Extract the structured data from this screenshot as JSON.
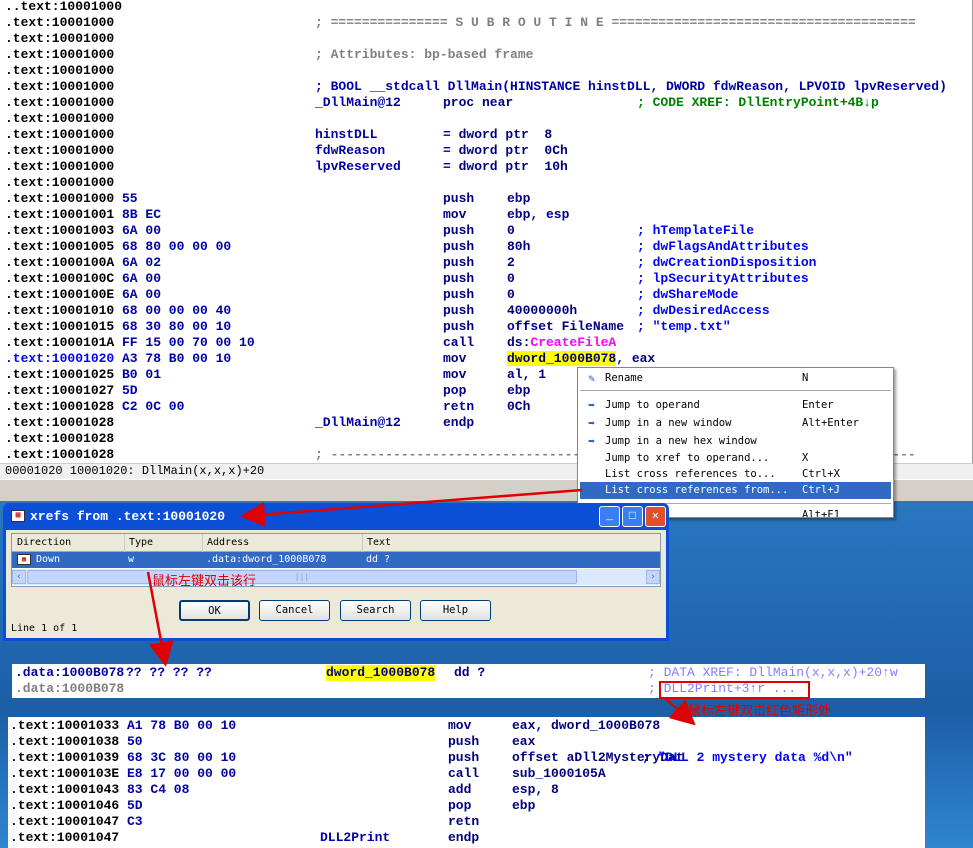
{
  "listing": [
    [
      "..text:10001000",
      "",
      "",
      "",
      "",
      ""
    ],
    [
      ".text:10001000",
      "",
      "; =============== S U B R O U T I N E =======================================",
      "",
      "",
      ""
    ],
    [
      ".text:10001000",
      "",
      "",
      "",
      "",
      ""
    ],
    [
      ".text:10001000",
      "",
      "; Attributes: bp-based frame",
      "",
      "",
      ""
    ],
    [
      ".text:10001000",
      "",
      "",
      "",
      "",
      ""
    ],
    [
      ".text:10001000",
      "",
      "; BOOL __stdcall DllMain(HINSTANCE hinstDLL, DWORD fdwReason, LPVOID lpvReserved)",
      "",
      "",
      ""
    ],
    [
      ".text:10001000",
      "",
      "_DllMain@12",
      "proc near",
      "",
      "; CODE XREF: DllEntryPoint+4B↓p"
    ],
    [
      ".text:10001000",
      "",
      "",
      "",
      "",
      ""
    ],
    [
      ".text:10001000",
      "",
      "hinstDLL",
      "= dword ptr  8",
      "",
      ""
    ],
    [
      ".text:10001000",
      "",
      "fdwReason",
      "= dword ptr  0Ch",
      "",
      ""
    ],
    [
      ".text:10001000",
      "",
      "lpvReserved",
      "= dword ptr  10h",
      "",
      ""
    ],
    [
      ".text:10001000",
      "",
      "",
      "",
      "",
      ""
    ],
    [
      ".text:10001000",
      "55",
      "",
      "push",
      "ebp",
      ""
    ],
    [
      ".text:10001001",
      "8B EC",
      "",
      "mov",
      "ebp, esp",
      ""
    ],
    [
      ".text:10001003",
      "6A 00",
      "",
      "push",
      "0",
      "; hTemplateFile"
    ],
    [
      ".text:10001005",
      "68 80 00 00 00",
      "",
      "push",
      "80h",
      "; dwFlagsAndAttributes"
    ],
    [
      ".text:1000100A",
      "6A 02",
      "",
      "push",
      "2",
      "; dwCreationDisposition"
    ],
    [
      ".text:1000100C",
      "6A 00",
      "",
      "push",
      "0",
      "; lpSecurityAttributes"
    ],
    [
      ".text:1000100E",
      "6A 00",
      "",
      "push",
      "0",
      "; dwShareMode"
    ],
    [
      ".text:10001010",
      "68 00 00 00 40",
      "",
      "push",
      "40000000h",
      "; dwDesiredAccess"
    ],
    [
      ".text:10001015",
      "68 30 80 00 10",
      "",
      "push",
      "offset FileName",
      "; \"temp.txt\""
    ],
    [
      ".text:1000101A",
      "FF 15 00 70 00 10",
      "",
      "call",
      "ds:CreateFileA",
      ""
    ],
    [
      ".text:10001020",
      "A3 78 B0 00 10",
      "",
      "mov",
      "dword_1000B078, eax",
      ""
    ],
    [
      ".text:10001025",
      "B0 01",
      "",
      "mov",
      "al, 1",
      ""
    ],
    [
      ".text:10001027",
      "5D",
      "",
      "pop",
      "ebp",
      ""
    ],
    [
      ".text:10001028",
      "C2 0C 00",
      "",
      "retn",
      "0Ch",
      ""
    ],
    [
      ".text:10001028",
      "",
      "_DllMain@12",
      "endp",
      "",
      ""
    ],
    [
      ".text:10001028",
      "",
      "",
      "",
      "",
      ""
    ],
    [
      ".text:10001028",
      "",
      "; ---------------------------------------------------------------------------",
      "",
      "",
      ""
    ]
  ],
  "status": "00001020 10001020: DllMain(x,x,x)+20",
  "menu": {
    "items": [
      {
        "label": "Rename",
        "key": "N",
        "icon": "rename-icon"
      },
      {
        "label": "Jump to operand",
        "key": "Enter",
        "icon": "jump-arrow-icon"
      },
      {
        "label": "Jump in a new window",
        "key": "Alt+Enter",
        "icon": "new-window-jump-icon"
      },
      {
        "label": "Jump in a new hex window",
        "key": "",
        "icon": "hex-window-jump-icon"
      },
      {
        "label": "Jump to xref to operand...",
        "key": "X",
        "icon": ""
      },
      {
        "label": "List cross references to...",
        "key": "Ctrl+X",
        "icon": ""
      },
      {
        "label": "List cross references from...",
        "key": "Ctrl+J",
        "icon": "",
        "selected": true
      },
      {
        "label": "",
        "key": "Alt+F1",
        "icon": ""
      }
    ]
  },
  "dialog": {
    "title": "xrefs from .text:10001020",
    "columns": [
      "Direction",
      "Type",
      "Address",
      "Text"
    ],
    "rows": [
      [
        "Down",
        "w",
        ".data:dword_1000B078",
        "dd ?"
      ]
    ],
    "buttons": [
      "OK",
      "Cancel",
      "Search",
      "Help"
    ],
    "line_info": "Line 1 of 1",
    "scroll_grip": "|||"
  },
  "annotations": {
    "dblclick_row": "鼠标左键双击该行",
    "dblclick_redbox": "鼠标左键双击红色矩形处"
  },
  "data_snippet": {
    "line1": {
      "addr": ".data:1000B078",
      "bytes": "?? ?? ?? ??",
      "label": "dword_1000B078",
      "op": "dd ?",
      "comment": "; DATA XREF: DllMain(x,x,x)+20↑w"
    },
    "line2": {
      "addr": ".data:1000B078",
      "comment": "; DLL2Print+3↑r ..."
    }
  },
  "code_snippet": [
    [
      ".text:10001033",
      "A1 78 B0 00 10",
      "",
      "mov",
      "eax, dword_1000B078",
      ""
    ],
    [
      ".text:10001038",
      "50",
      "",
      "push",
      "eax",
      ""
    ],
    [
      ".text:10001039",
      "68 3C 80 00 10",
      "",
      "push",
      "offset aDll2MysteryDat",
      "; \"DLL 2 mystery data %d\\n\""
    ],
    [
      ".text:1000103E",
      "E8 17 00 00 00",
      "",
      "call",
      "sub_1000105A",
      ""
    ],
    [
      ".text:10001043",
      "83 C4 08",
      "",
      "add",
      "esp, 8",
      ""
    ],
    [
      ".text:10001046",
      "5D",
      "",
      "pop",
      "ebp",
      ""
    ],
    [
      ".text:10001047",
      "C3",
      "",
      "retn",
      "",
      ""
    ],
    [
      ".text:10001047",
      "",
      "DLL2Print",
      "endp",
      "",
      ""
    ]
  ],
  "colors": {
    "highlight": "#ffff00",
    "selection": "#316ac5",
    "annotation": "#e00000",
    "titlebar": "#0a4fd6"
  }
}
